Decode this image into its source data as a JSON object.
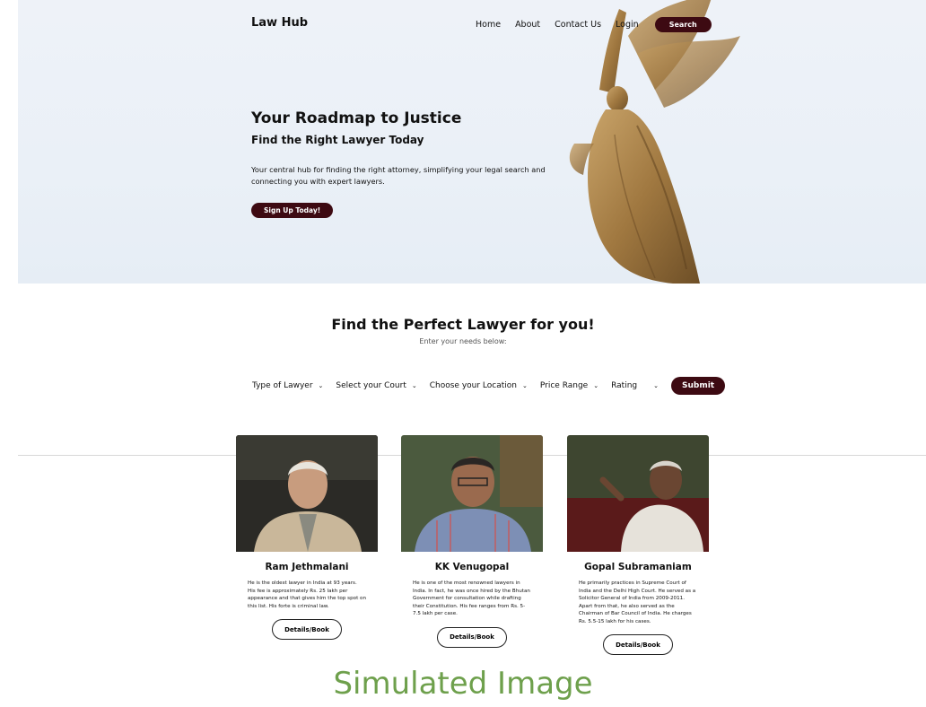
{
  "nav": {
    "logo": "Law Hub",
    "links": [
      "Home",
      "About",
      "Contact Us",
      "Login"
    ],
    "search_label": "Search"
  },
  "hero": {
    "title": "Your Roadmap to Justice",
    "subtitle": "Find the Right Lawyer Today",
    "description": "Your central hub for finding the right attorney, simplifying your legal search and connecting you with expert lawyers.",
    "cta": "Sign Up Today!"
  },
  "find": {
    "title": "Find the Perfect Lawyer for you!",
    "subtitle": "Enter your needs below:",
    "filters": [
      "Type of Lawyer",
      "Select your Court",
      "Choose your Location",
      "Price Range",
      "Rating"
    ],
    "submit": "Submit"
  },
  "lawyers": [
    {
      "name": "Ram Jethmalani",
      "description": "He is the oldest lawyer in India at 93 years. His fee is approximately Rs. 25 lakh per appearance and that gives him the top spot on this list. His forte is criminal law.",
      "button": "Details/Book"
    },
    {
      "name": "KK Venugopal",
      "description": "He is one of the most renowned lawyers in India. In fact, he was once hired by the Bhutan Government for consultation while drafting their Constitution. His fee ranges from Rs. 5-7.5 lakh per case.",
      "button": "Details/Book"
    },
    {
      "name": "Gopal Subramaniam",
      "description": "He primarily practices in Supreme Court of India and the Delhi High Court. He served as a Solicitor General of India from 2009-2011. Apart from that, he also served as the Chairman of Bar Council of India. He charges Rs. 5.5-15 lakh for his cases.",
      "button": "Details/Book"
    }
  ],
  "watermark": "Simulated Image",
  "colors": {
    "accent": "#3d0a12",
    "hero_bg": "#eaf0f7",
    "watermark": "#6ea04c"
  }
}
